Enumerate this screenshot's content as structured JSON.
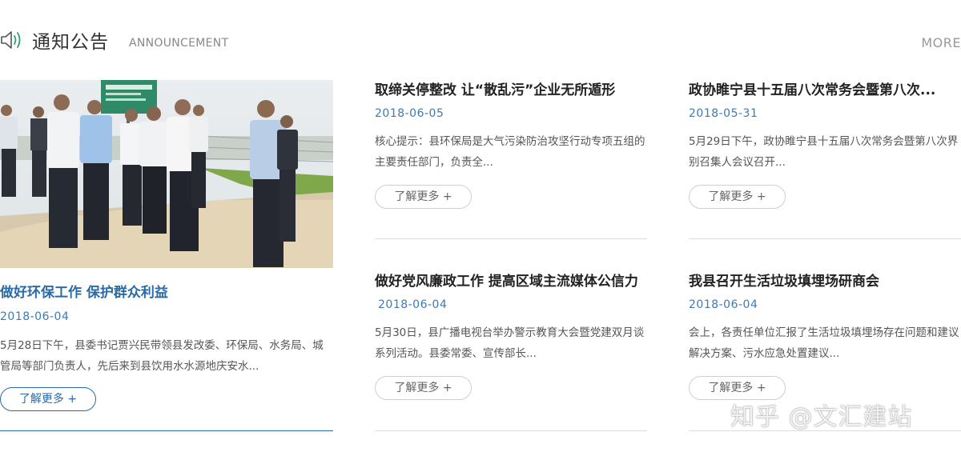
{
  "header": {
    "icon": "speaker-icon",
    "title": "通知公告",
    "subtitle": "ANNOUNCEMENT",
    "more_label": "MORE"
  },
  "featured": {
    "title": "做好环保工作 保护群众利益",
    "date": "2018-06-04",
    "summary": "5月28日下午，县委书记贾兴民带领县发改委、环保局、水务局、城管局等部门负责人，先后来到县饮用水水源地庆安水...",
    "button_label": "了解更多 +",
    "accent_color": "#2a6aa6"
  },
  "items": [
    {
      "title": "取缔关停整改 让“散乱污”企业无所遁形",
      "date": "2018-06-05",
      "summary": "核心提示：县环保局是大气污染防治攻坚行动专项五组的主要责任部门，负责全...",
      "button_label": "了解更多 +"
    },
    {
      "title": "政协睢宁县十五届八次常务会暨第八次...",
      "date": "2018-05-31",
      "summary": "5月29日下午，政协睢宁县十五届八次常务会暨第八次界别召集人会议召开...",
      "button_label": "了解更多 +"
    },
    {
      "title": "做好党风廉政工作 提高区域主流媒体公信力",
      "date": "2018-06-04",
      "summary": "5月30日，县广播电视台举办警示教育大会暨党建双月谈系列活动。县委常委、宣传部长...",
      "button_label": "了解更多 +"
    },
    {
      "title": "我县召开生活垃圾填埋场研商会",
      "date": "2018-06-04",
      "summary": "会上，各责任单位汇报了生活垃圾填埋场存在问题和建议解决方案、污水应急处置建议...",
      "button_label": "了解更多 +"
    }
  ],
  "watermark": "知乎 @文汇建站"
}
